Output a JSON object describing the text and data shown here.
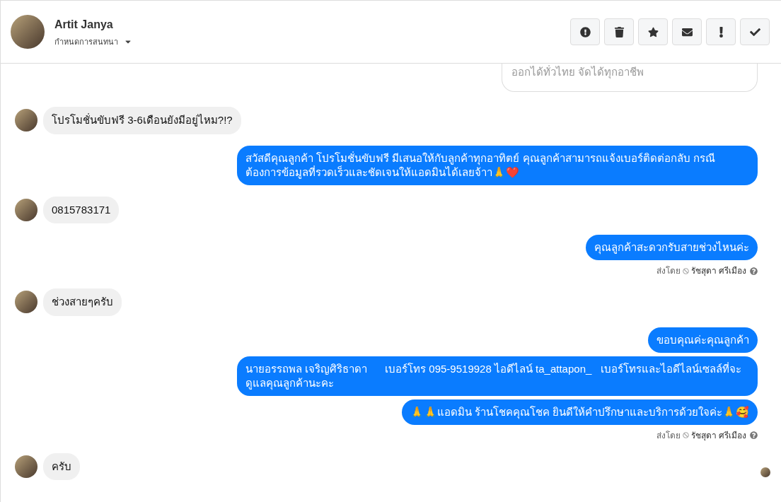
{
  "header": {
    "name": "Artit Janya",
    "subtitle": "กำหนดการสนทนา"
  },
  "actions": [
    {
      "kind": "alert-circle"
    },
    {
      "kind": "trash"
    },
    {
      "kind": "star"
    },
    {
      "kind": "envelope"
    },
    {
      "kind": "exclamation"
    },
    {
      "kind": "check"
    }
  ],
  "preview_card": {
    "text": "ออกได้ทั่วไทย จัดได้ทุกอาชีพ"
  },
  "messages": [
    {
      "kind": "incoming",
      "text": "โปรโมชั่นขับฟรี 3-6เดือนยังมีอยู่ไหม?!?"
    },
    {
      "kind": "outgoing",
      "text": "สวัสดีคุณลูกค้า โปรโมชั่นขับฟรี มีเสนอให้กับลูกค้าทุกอาทิตย์ คุณลูกค้าสามารถแจ้งเบอร์ติดต่อกลับ กรณีต้องการข้อมูลที่รวดเร็วและชัดเจนให้แอดมินได้เลยจ้าา🙏❤️"
    },
    {
      "kind": "incoming",
      "text": "0815783171"
    },
    {
      "kind": "outgoing",
      "text": "คุณลูกค้าสะดวกรับสายช่วงไหนค่ะ"
    },
    {
      "kind": "meta",
      "label": "ส่งโดย",
      "sender": "รัชสุดา ศรีเมือง"
    },
    {
      "kind": "incoming",
      "text": "ช่วงสายๆครับ"
    },
    {
      "kind": "outgoing",
      "text": "ขอบคุณค่ะคุณลูกค้า"
    },
    {
      "kind": "outgoing",
      "text": "นายอรรถพล เจริญศิริธาดา      เบอร์โทร 095-9519928 ไอดีไลน์ ta_attapon_   เบอร์โทรและไอดีไลน์เซลล์ที่จะดูแลคุณลูกค้านะคะ"
    },
    {
      "kind": "outgoing",
      "text": "🙏🙏แอดมิน ร้านโชคคุณโชค ยินดีให้คำปรึกษาและบริการด้วยใจค่ะ🙏🥰"
    },
    {
      "kind": "meta",
      "label": "ส่งโดย",
      "sender": "รัชสุดา ศรีเมือง"
    },
    {
      "kind": "incoming",
      "text": "ครับ",
      "seen": true
    }
  ]
}
